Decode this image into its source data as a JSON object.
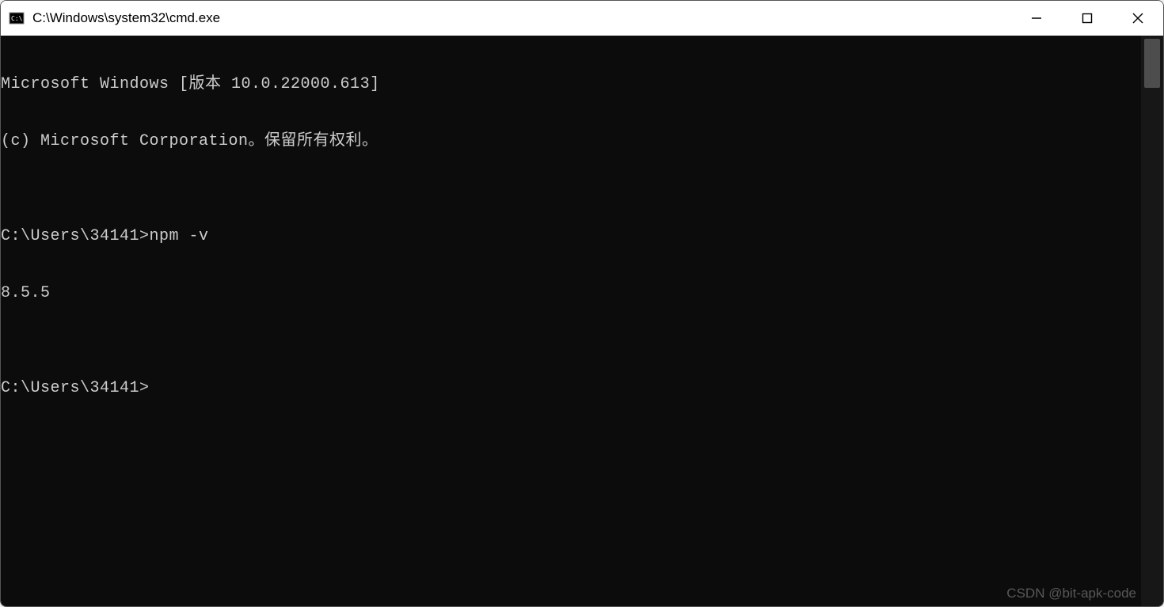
{
  "window": {
    "title": "C:\\Windows\\system32\\cmd.exe"
  },
  "terminal": {
    "lines": [
      "Microsoft Windows [版本 10.0.22000.613]",
      "(c) Microsoft Corporation。保留所有权利。",
      "",
      "C:\\Users\\34141>npm -v",
      "8.5.5",
      "",
      "C:\\Users\\34141>"
    ]
  },
  "watermark": "CSDN @bit-apk-code"
}
